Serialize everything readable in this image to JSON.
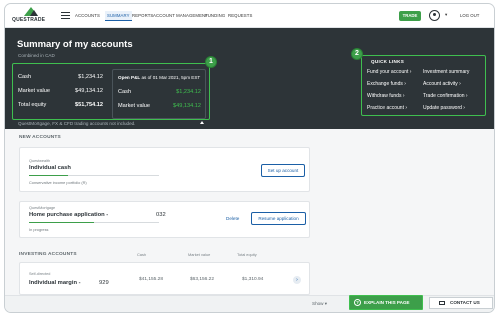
{
  "brand": {
    "name": "QUESTRADE"
  },
  "nav": {
    "items": [
      "ACCOUNTS",
      "SUMMARY",
      "REPORTS",
      "ACCOUNT MANAGEMENT",
      "FUNDING",
      "REQUESTS"
    ],
    "trade": "TRADE",
    "logout": "LOG OUT"
  },
  "summary": {
    "title": "Summary of my accounts",
    "subtitle": "Combined in CAD",
    "cash_label": "Cash",
    "cash": "$1,234.12",
    "mv_label": "Market value",
    "mv": "$49,134.12",
    "te_label": "Total equity",
    "te": "$51,754.12",
    "pnl_label": "Open P&L",
    "pnl_date": "as of 01 Mar 2021, 5pm EST",
    "pnl_cash_label": "Cash",
    "pnl_cash": "$1,234.12",
    "pnl_mv_label": "Market value",
    "pnl_mv": "$49,134.12",
    "footnote": "QuestMortgage, FX & CFD trading accounts not included."
  },
  "badges": [
    "1",
    "2"
  ],
  "quick_links": {
    "title": "QUICK LINKS",
    "items": [
      "Fund your account ›",
      "Investment summary",
      "Exchange funds ›",
      "Account activity ›",
      "Withdraw funds ›",
      "Trade confirmation ›",
      "Practice account ›",
      "Update password ›"
    ]
  },
  "new_accounts": {
    "title": "NEW ACCOUNTS",
    "card1": {
      "provider": "Questwealth",
      "name": "Individual cash",
      "desc": "Conservative income portfolio (R)",
      "button": "Set up account",
      "progress": 0.3
    },
    "card2": {
      "provider": "QuestMortgage",
      "name": "Home purchase application -",
      "number": "032",
      "desc": "In progress",
      "delete": "Delete",
      "resume": "Resume application",
      "progress": 0.5
    }
  },
  "investing": {
    "title": "INVESTING ACCOUNTS",
    "cols": [
      "Cash",
      "Market value",
      "Total equity"
    ],
    "row": {
      "type": "Self-directed",
      "name": "Individual margin -",
      "number": "929",
      "cash": "$41,155.28",
      "mv": "$63,156.22",
      "te": "$1,310.94"
    }
  },
  "footer": {
    "show": "Show",
    "explain": "EXPLAIN THIS PAGE",
    "contact": "CONTACT US"
  },
  "colors": {
    "accent": "#3d9f4a",
    "dark": "#2d3438",
    "link": "#1b5fa6"
  }
}
